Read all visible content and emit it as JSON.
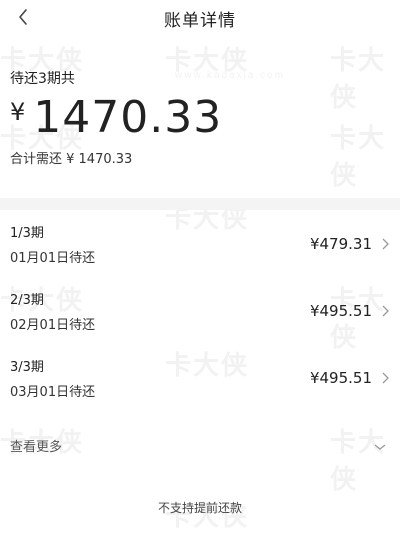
{
  "header": {
    "title": "账单详情"
  },
  "summary": {
    "periods_label": "待还3期共",
    "currency_symbol": "¥",
    "amount": "1470.33",
    "total_line": "合计需还 ¥ 1470.33"
  },
  "installments": [
    {
      "period": "1/3期",
      "date": "01月01日待还",
      "amount": "¥479.31"
    },
    {
      "period": "2/3期",
      "date": "02月01日待还",
      "amount": "¥495.51"
    },
    {
      "period": "3/3期",
      "date": "03月01日待还",
      "amount": "¥495.51"
    }
  ],
  "more": {
    "label": "查看更多"
  },
  "footer": {
    "text": "不支持提前还款"
  },
  "watermark": {
    "brand": "卡大侠",
    "site": "www.kadaxia.com"
  },
  "icons": {
    "back": "chevron-left-icon",
    "row_arrow": "chevron-right-icon",
    "expand": "chevron-down-icon"
  }
}
